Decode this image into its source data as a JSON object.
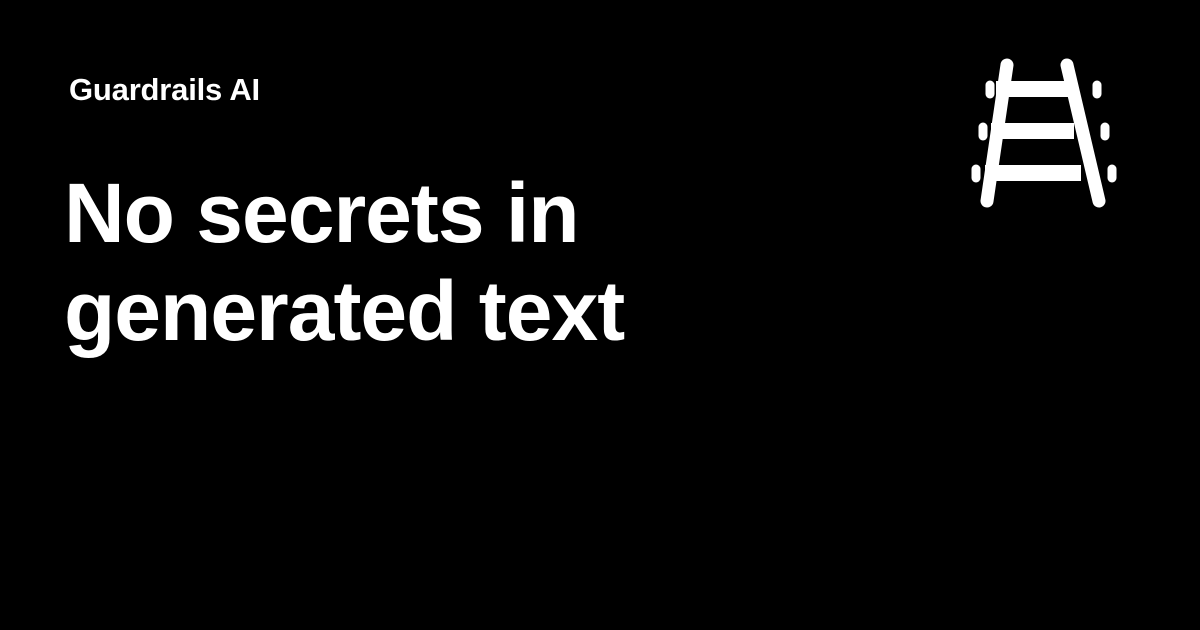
{
  "brand": {
    "name": "Guardrails AI",
    "logo_icon": "railroad-track-icon",
    "logo_color": "#ffffff"
  },
  "headline": {
    "line1": "No secrets in",
    "line2": "generated text"
  },
  "colors": {
    "background": "#000000",
    "text": "#ffffff"
  }
}
